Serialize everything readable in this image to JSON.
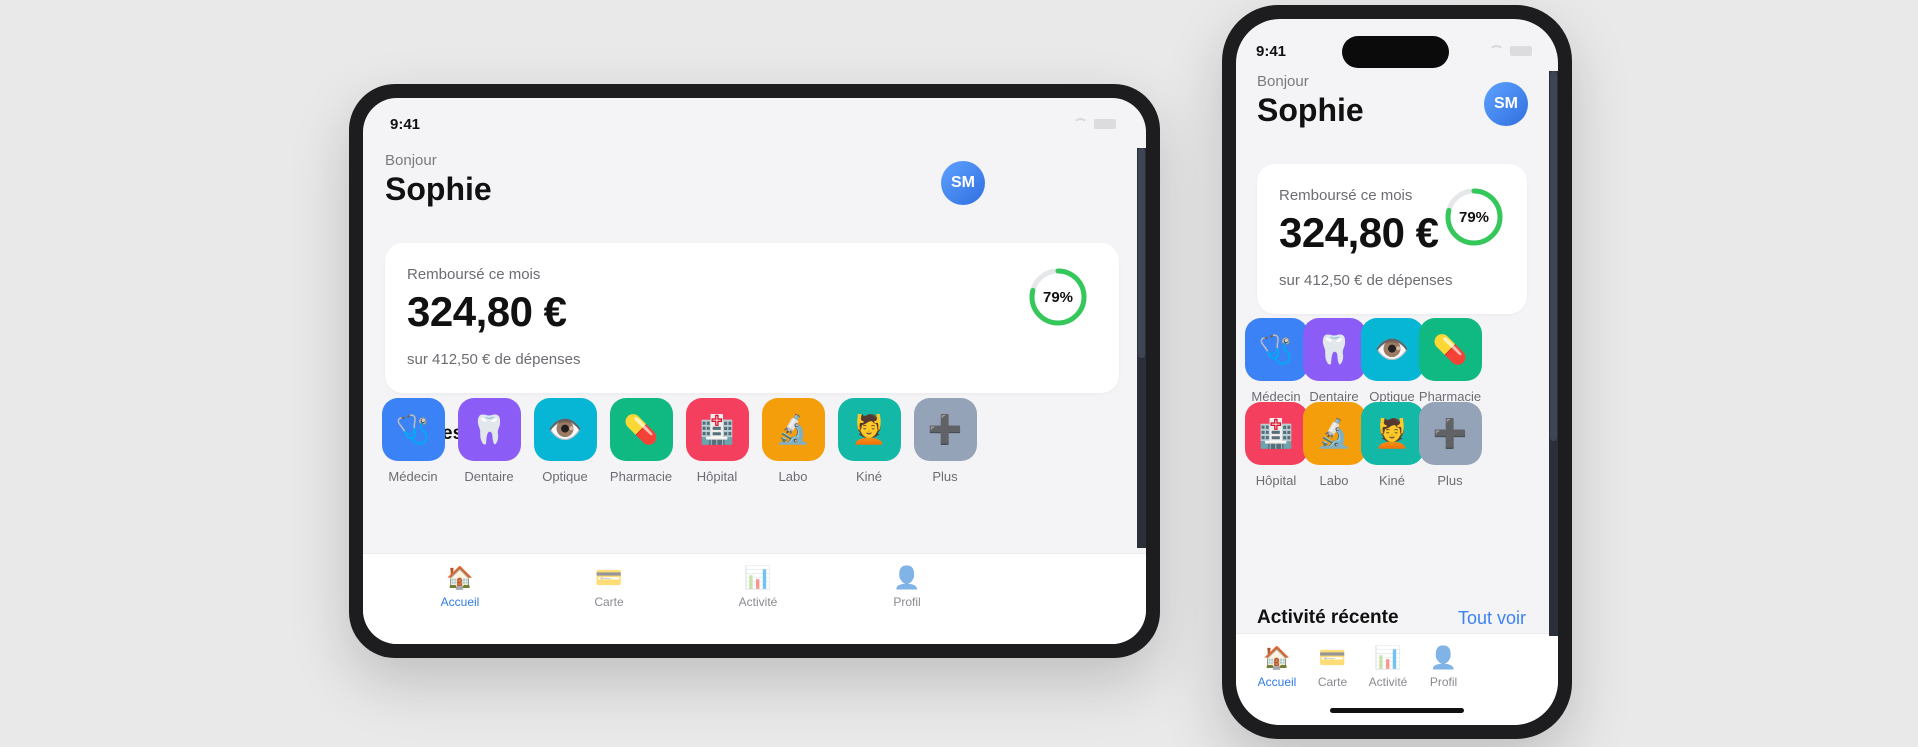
{
  "status_bar": {
    "time": "9:41"
  },
  "greeting": {
    "hello": "Bonjour",
    "name": "Sophie",
    "avatar_initials": "SM"
  },
  "reimbursement": {
    "label": "Remboursé ce mois",
    "amount": "324,80 €",
    "subtitle": "sur 412,50 € de dépenses",
    "percent_label": "79%",
    "percent_value": 79,
    "ring_color": "#34c759"
  },
  "services": {
    "title": "Services",
    "items": [
      {
        "label": "Médecin",
        "icon": "stethoscope-icon",
        "glyph": "🩺",
        "color": "#3b82f6"
      },
      {
        "label": "Dentaire",
        "icon": "tooth-icon",
        "glyph": "🦷",
        "color": "#8b5cf6"
      },
      {
        "label": "Optique",
        "icon": "eye-icon",
        "glyph": "👁️",
        "color": "#06b6d4"
      },
      {
        "label": "Pharmacie",
        "icon": "pill-icon",
        "glyph": "💊",
        "color": "#10b981"
      },
      {
        "label": "Hôpital",
        "icon": "hospital-icon",
        "glyph": "🏥",
        "color": "#f43f5e"
      },
      {
        "label": "Labo",
        "icon": "microscope-icon",
        "glyph": "🔬",
        "color": "#f59e0b"
      },
      {
        "label": "Kiné",
        "icon": "therapy-icon",
        "glyph": "💆",
        "color": "#14b8a6"
      },
      {
        "label": "Plus",
        "icon": "plus-icon",
        "glyph": "➕",
        "color": "#94a3b8"
      }
    ]
  },
  "recent_activity": {
    "title": "Activité récente",
    "see_all": "Tout voir"
  },
  "tabbar": {
    "items": [
      {
        "label": "Accueil",
        "icon": "home-icon",
        "glyph": "🏠",
        "active": true
      },
      {
        "label": "Carte",
        "icon": "card-icon",
        "glyph": "💳",
        "active": false
      },
      {
        "label": "Activité",
        "icon": "chart-icon",
        "glyph": "📊",
        "active": false
      },
      {
        "label": "Profil",
        "icon": "profile-icon",
        "glyph": "👤",
        "active": false
      }
    ],
    "active_color": "#2f7be6"
  }
}
